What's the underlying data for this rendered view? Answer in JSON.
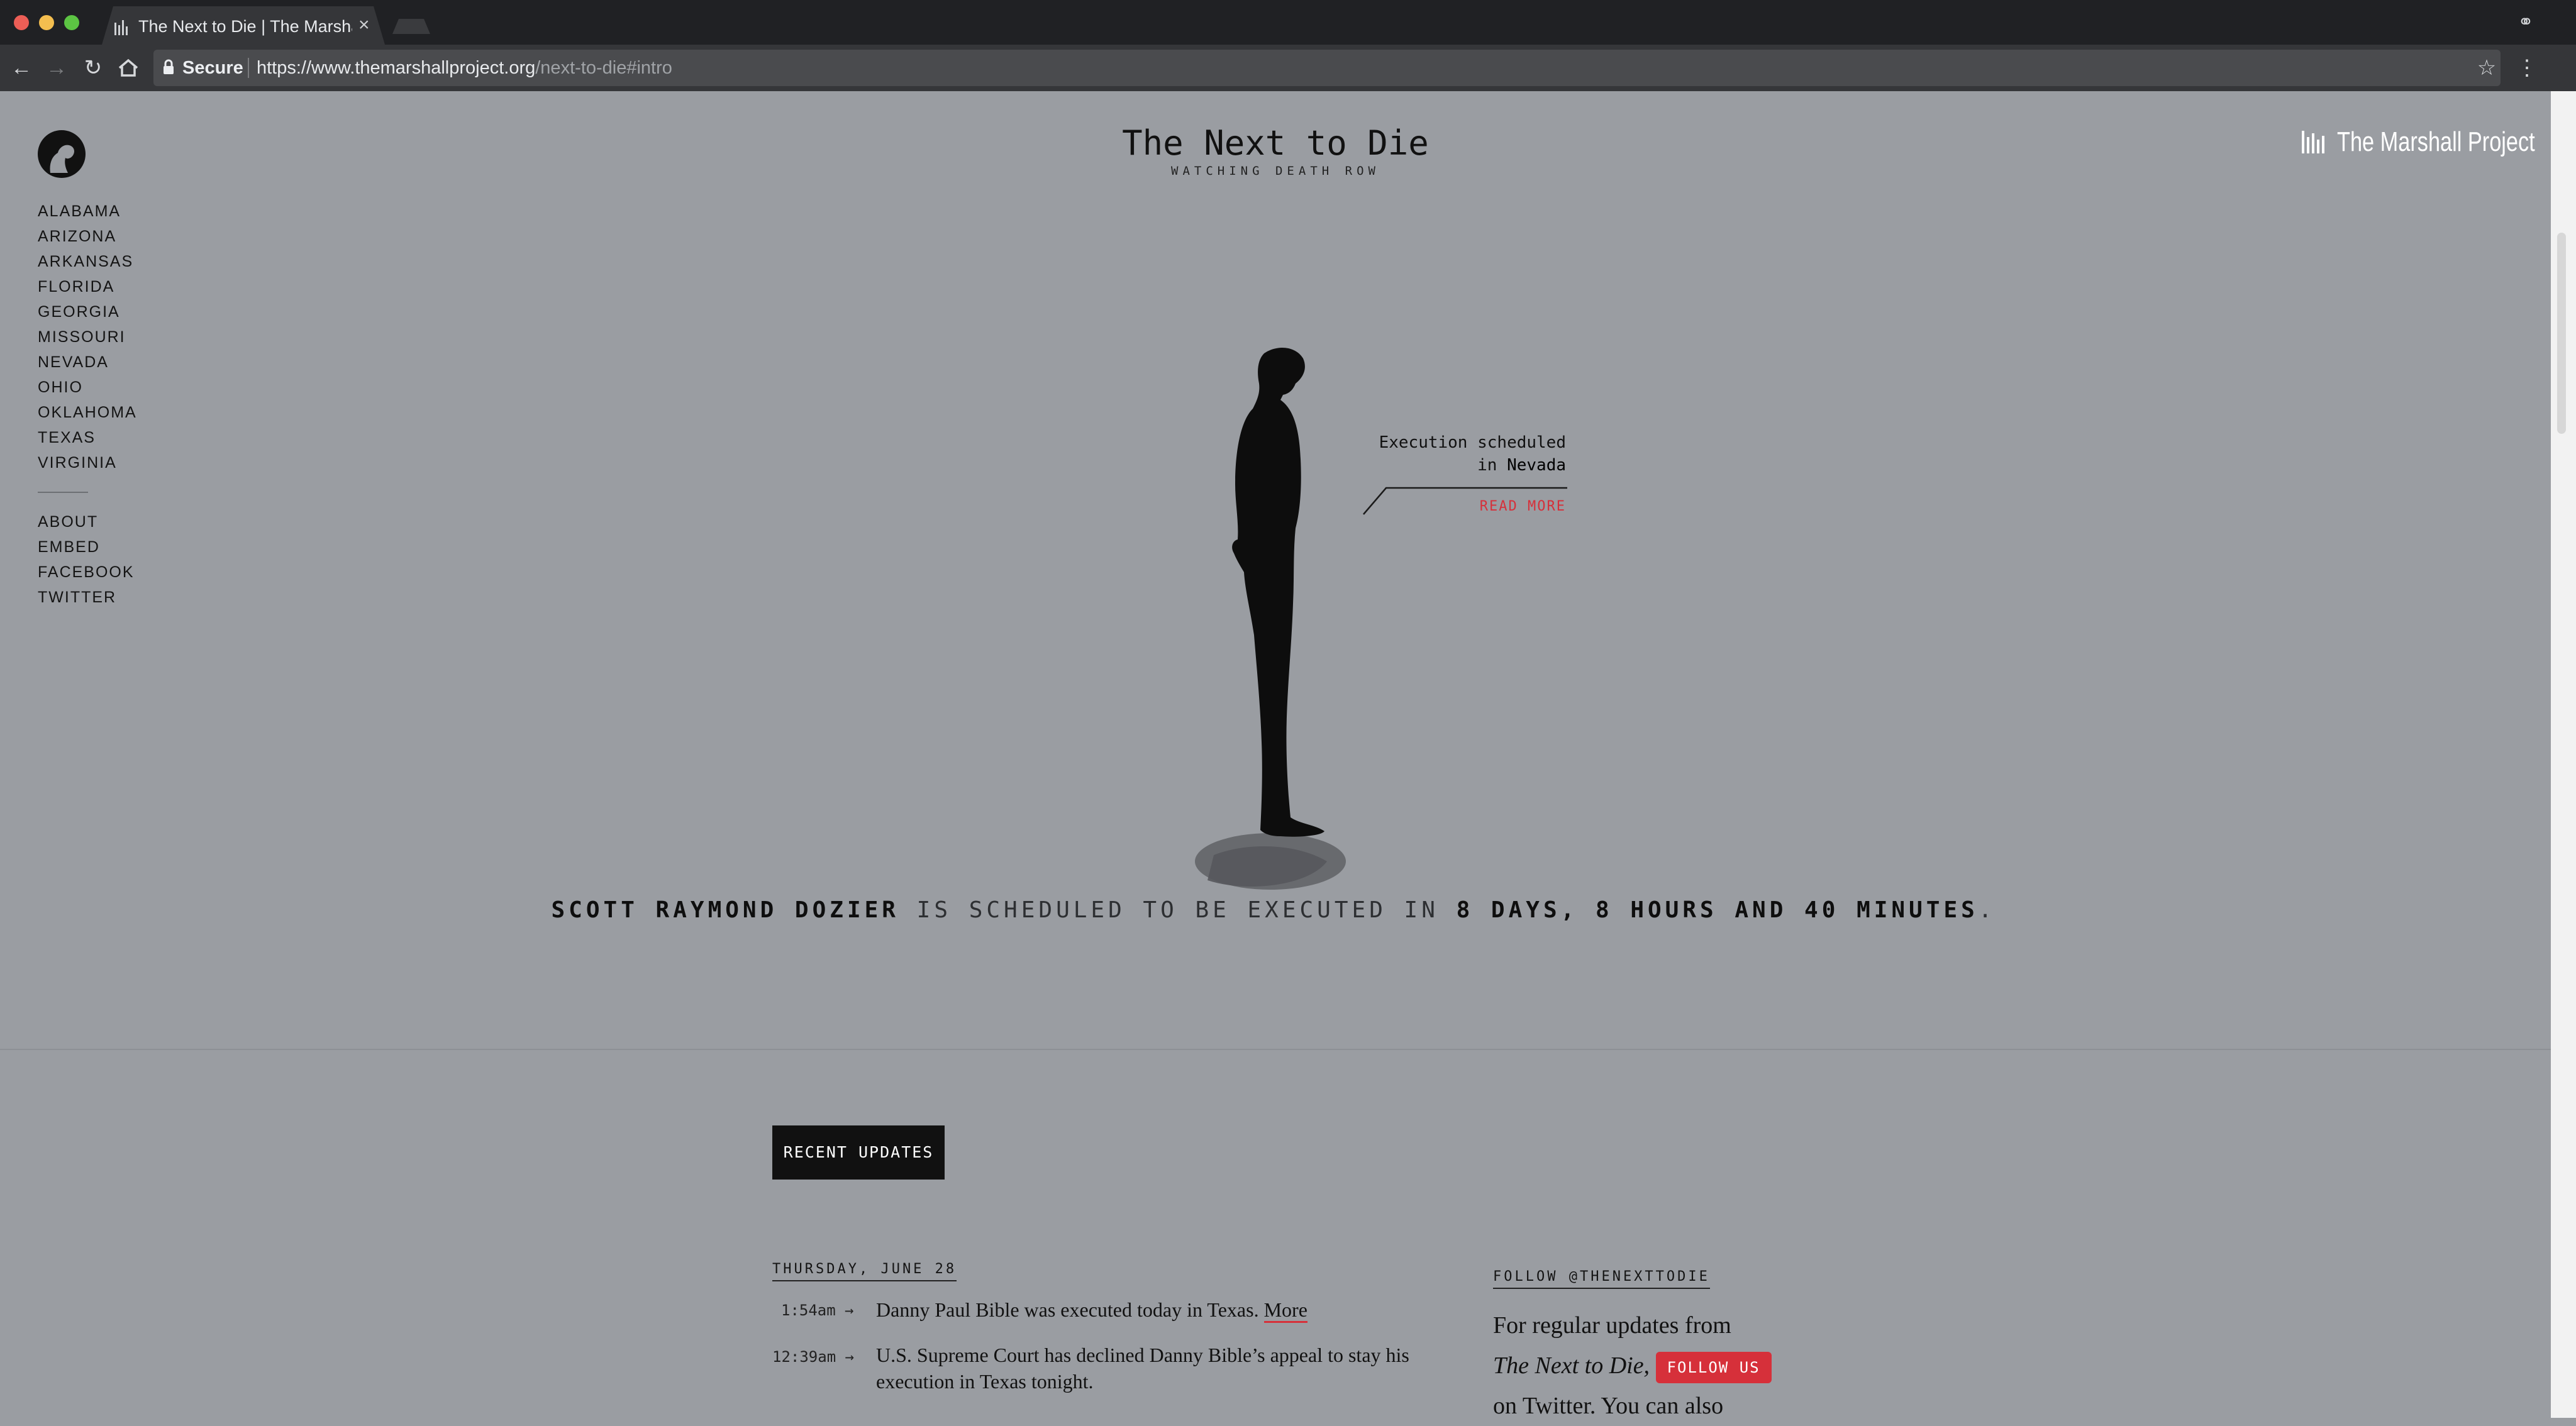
{
  "browser": {
    "tab_title": "The Next to Die | The Marshall Project",
    "tab_close": "×",
    "secure_label": "Secure",
    "url_main": "https://www.themarshallproject.org",
    "url_path": "/next-to-die#intro"
  },
  "site": {
    "title": "The Next to Die",
    "subtitle": "WATCHING DEATH ROW",
    "brand": "The Marshall Project"
  },
  "sidenav": {
    "states": [
      "ALABAMA",
      "ARIZONA",
      "ARKANSAS",
      "FLORIDA",
      "GEORGIA",
      "MISSOURI",
      "NEVADA",
      "OHIO",
      "OKLAHOMA",
      "TEXAS",
      "VIRGINIA"
    ],
    "links": [
      "ABOUT",
      "EMBED",
      "FACEBOOK",
      "TWITTER"
    ]
  },
  "callout": {
    "line1": "Execution scheduled",
    "line2_prefix": "in",
    "state": "Nevada",
    "read_more": "READ MORE"
  },
  "countdown": {
    "name": "SCOTT RAYMOND DOZIER",
    "phrase": "IS SCHEDULED TO BE EXECUTED IN",
    "time_left": "8 DAYS, 8 HOURS AND 40 MINUTES",
    "end": "."
  },
  "updates": {
    "button_label": "RECENT UPDATES",
    "date": "THURSDAY, JUNE 28",
    "items": [
      {
        "time": "1:54am →",
        "text": "Danny Paul Bible was executed today in Texas.",
        "more": "More"
      },
      {
        "time": "12:39am →",
        "text": "U.S. Supreme Court has declined Danny Bible’s appeal to stay his execution in Texas tonight."
      }
    ]
  },
  "follow": {
    "header": "FOLLOW @THENEXTTODIE",
    "text_1": "For regular updates from",
    "text_title": "The Next to Die,",
    "button": "FOLLOW US",
    "text_2": "on Twitter. You can also"
  },
  "colors": {
    "page_bg": "#9a9da2",
    "accent_red": "#d6303a",
    "chrome_dark": "#202124"
  }
}
